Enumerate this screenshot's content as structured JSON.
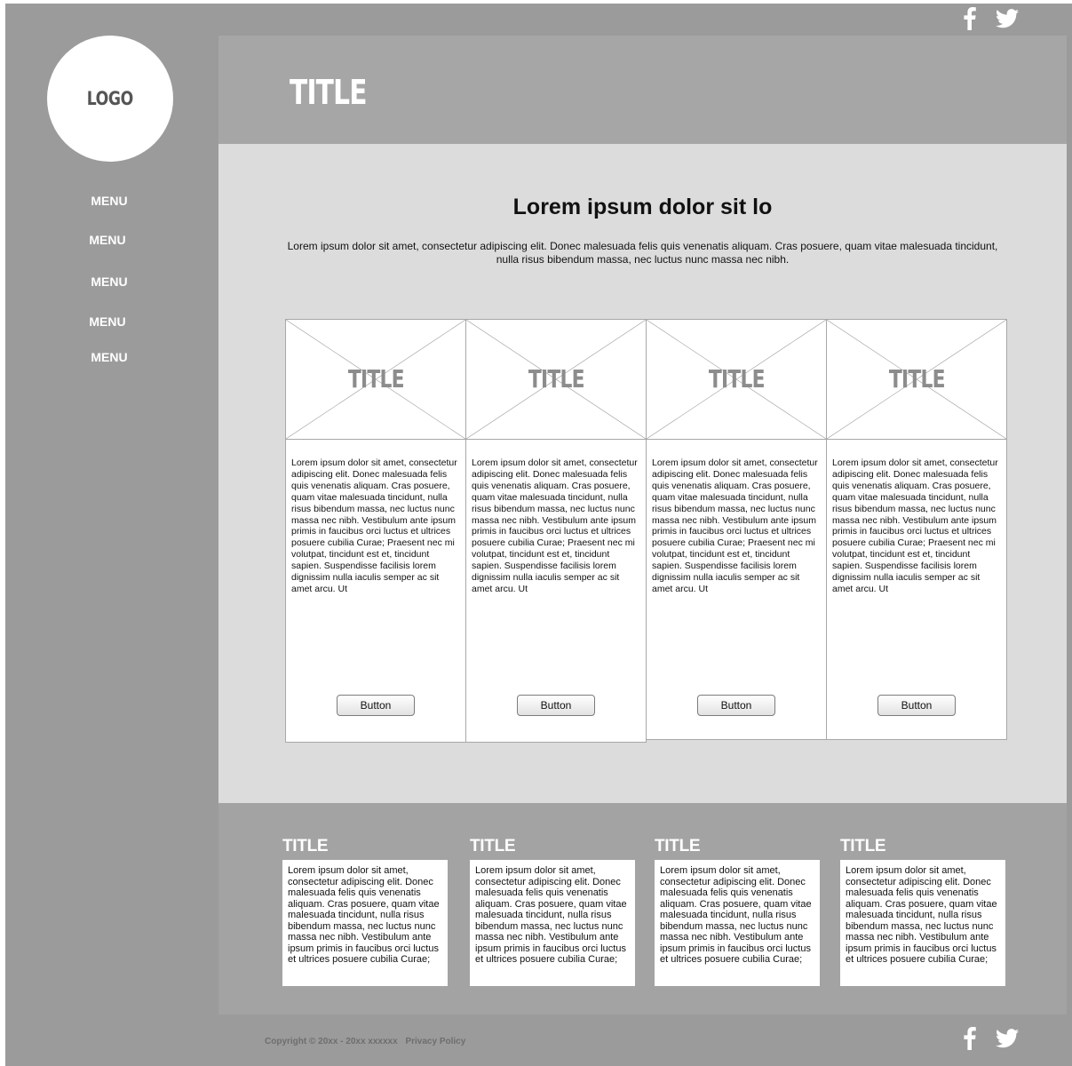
{
  "logo": {
    "text": "LOGO"
  },
  "header": {
    "title": "TITLE"
  },
  "menu": {
    "items": [
      "MENU",
      "MENU",
      "MENU",
      "MENU",
      "MENU"
    ]
  },
  "social": {
    "icons": [
      "facebook-icon",
      "twitter-icon"
    ]
  },
  "main": {
    "heading": "Lorem ipsum dolor sit lo",
    "intro": "Lorem ipsum dolor sit amet, consectetur adipiscing elit. Donec malesuada felis quis venenatis aliquam. Cras posuere, quam vitae malesuada tincidunt, nulla risus bibendum massa, nec luctus nunc massa nec nibh.",
    "cards": [
      {
        "image_title": "TITLE",
        "text": "Lorem ipsum dolor sit amet, consectetur adipiscing elit. Donec malesuada felis quis venenatis aliquam. Cras posuere, quam vitae malesuada tincidunt, nulla risus bibendum massa, nec luctus nunc massa nec nibh. Vestibulum ante ipsum primis in faucibus orci luctus et ultrices posuere cubilia Curae; Praesent nec mi volutpat, tincidunt est et, tincidunt sapien. Suspendisse facilisis lorem dignissim nulla iaculis semper ac sit amet arcu. Ut",
        "button": "Button"
      },
      {
        "image_title": "TITLE",
        "text": "Lorem ipsum dolor sit amet, consectetur adipiscing elit. Donec malesuada felis quis venenatis aliquam. Cras posuere, quam vitae malesuada tincidunt, nulla risus bibendum massa, nec luctus nunc massa nec nibh. Vestibulum ante ipsum primis in faucibus orci luctus et ultrices posuere cubilia Curae; Praesent nec mi volutpat, tincidunt est et, tincidunt sapien. Suspendisse facilisis lorem dignissim nulla iaculis semper ac sit amet arcu. Ut",
        "button": "Button"
      },
      {
        "image_title": "TITLE",
        "text": "Lorem ipsum dolor sit amet, consectetur adipiscing elit. Donec malesuada felis quis venenatis aliquam. Cras posuere, quam vitae malesuada tincidunt, nulla risus bibendum massa, nec luctus nunc massa nec nibh. Vestibulum ante ipsum primis in faucibus orci luctus et ultrices posuere cubilia Curae; Praesent nec mi volutpat, tincidunt est et, tincidunt sapien. Suspendisse facilisis lorem dignissim nulla iaculis semper ac sit amet arcu. Ut",
        "button": "Button"
      },
      {
        "image_title": "TITLE",
        "text": "Lorem ipsum dolor sit amet, consectetur adipiscing elit. Donec malesuada felis quis venenatis aliquam. Cras posuere, quam vitae malesuada tincidunt, nulla risus bibendum massa, nec luctus nunc massa nec nibh. Vestibulum ante ipsum primis in faucibus orci luctus et ultrices posuere cubilia Curae; Praesent nec mi volutpat, tincidunt est et, tincidunt sapien. Suspendisse facilisis lorem dignissim nulla iaculis semper ac sit amet arcu. Ut",
        "button": "Button"
      }
    ]
  },
  "footer": {
    "columns": [
      {
        "title": "TITLE",
        "text": "Lorem ipsum dolor sit amet, consectetur adipiscing elit. Donec malesuada felis quis venenatis aliquam. Cras posuere, quam vitae malesuada tincidunt, nulla risus bibendum massa, nec luctus nunc massa nec nibh. Vestibulum ante ipsum primis in faucibus orci luctus et ultrices posuere cubilia Curae;"
      },
      {
        "title": "TITLE",
        "text": "Lorem ipsum dolor sit amet, consectetur adipiscing elit. Donec malesuada felis quis venenatis aliquam. Cras posuere, quam vitae malesuada tincidunt, nulla risus bibendum massa, nec luctus nunc massa nec nibh. Vestibulum ante ipsum primis in faucibus orci luctus et ultrices posuere cubilia Curae;"
      },
      {
        "title": "TITLE",
        "text": "Lorem ipsum dolor sit amet, consectetur adipiscing elit. Donec malesuada felis quis venenatis aliquam. Cras posuere, quam vitae malesuada tincidunt, nulla risus bibendum massa, nec luctus nunc massa nec nibh. Vestibulum ante ipsum primis in faucibus orci luctus et ultrices posuere cubilia Curae;"
      },
      {
        "title": "TITLE",
        "text": "Lorem ipsum dolor sit amet, consectetur adipiscing elit. Donec malesuada felis quis venenatis aliquam. Cras posuere, quam vitae malesuada tincidunt, nulla risus bibendum massa, nec luctus nunc massa nec nibh. Vestibulum ante ipsum primis in faucibus orci luctus et ultrices posuere cubilia Curae;"
      }
    ],
    "copyright": "Copyright © 20xx - 20xx xxxxxx",
    "privacy": "Privacy Policy"
  }
}
